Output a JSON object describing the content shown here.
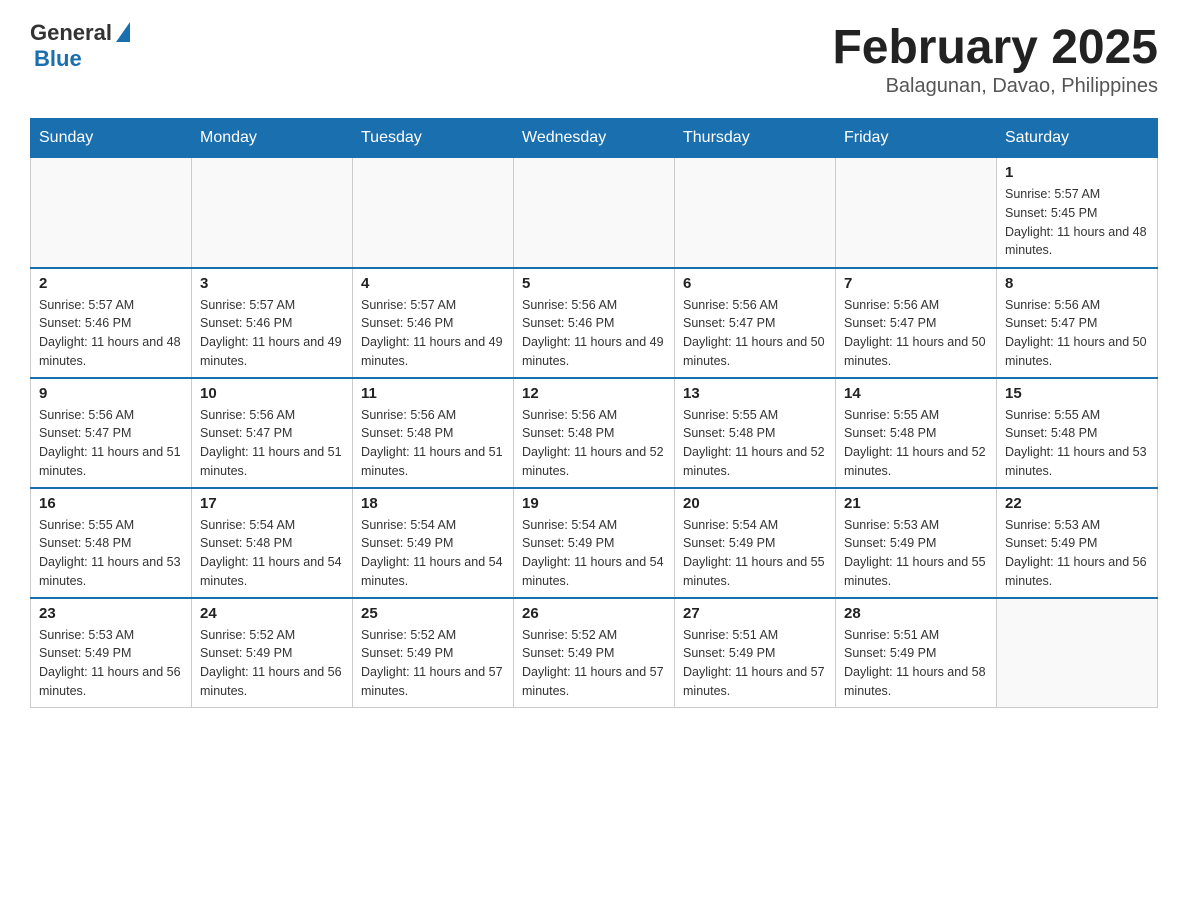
{
  "logo": {
    "general": "General",
    "blue": "Blue"
  },
  "header": {
    "title": "February 2025",
    "subtitle": "Balagunan, Davao, Philippines"
  },
  "days_of_week": [
    "Sunday",
    "Monday",
    "Tuesday",
    "Wednesday",
    "Thursday",
    "Friday",
    "Saturday"
  ],
  "weeks": [
    [
      {
        "day": "",
        "info": ""
      },
      {
        "day": "",
        "info": ""
      },
      {
        "day": "",
        "info": ""
      },
      {
        "day": "",
        "info": ""
      },
      {
        "day": "",
        "info": ""
      },
      {
        "day": "",
        "info": ""
      },
      {
        "day": "1",
        "info": "Sunrise: 5:57 AM\nSunset: 5:45 PM\nDaylight: 11 hours and 48 minutes."
      }
    ],
    [
      {
        "day": "2",
        "info": "Sunrise: 5:57 AM\nSunset: 5:46 PM\nDaylight: 11 hours and 48 minutes."
      },
      {
        "day": "3",
        "info": "Sunrise: 5:57 AM\nSunset: 5:46 PM\nDaylight: 11 hours and 49 minutes."
      },
      {
        "day": "4",
        "info": "Sunrise: 5:57 AM\nSunset: 5:46 PM\nDaylight: 11 hours and 49 minutes."
      },
      {
        "day": "5",
        "info": "Sunrise: 5:56 AM\nSunset: 5:46 PM\nDaylight: 11 hours and 49 minutes."
      },
      {
        "day": "6",
        "info": "Sunrise: 5:56 AM\nSunset: 5:47 PM\nDaylight: 11 hours and 50 minutes."
      },
      {
        "day": "7",
        "info": "Sunrise: 5:56 AM\nSunset: 5:47 PM\nDaylight: 11 hours and 50 minutes."
      },
      {
        "day": "8",
        "info": "Sunrise: 5:56 AM\nSunset: 5:47 PM\nDaylight: 11 hours and 50 minutes."
      }
    ],
    [
      {
        "day": "9",
        "info": "Sunrise: 5:56 AM\nSunset: 5:47 PM\nDaylight: 11 hours and 51 minutes."
      },
      {
        "day": "10",
        "info": "Sunrise: 5:56 AM\nSunset: 5:47 PM\nDaylight: 11 hours and 51 minutes."
      },
      {
        "day": "11",
        "info": "Sunrise: 5:56 AM\nSunset: 5:48 PM\nDaylight: 11 hours and 51 minutes."
      },
      {
        "day": "12",
        "info": "Sunrise: 5:56 AM\nSunset: 5:48 PM\nDaylight: 11 hours and 52 minutes."
      },
      {
        "day": "13",
        "info": "Sunrise: 5:55 AM\nSunset: 5:48 PM\nDaylight: 11 hours and 52 minutes."
      },
      {
        "day": "14",
        "info": "Sunrise: 5:55 AM\nSunset: 5:48 PM\nDaylight: 11 hours and 52 minutes."
      },
      {
        "day": "15",
        "info": "Sunrise: 5:55 AM\nSunset: 5:48 PM\nDaylight: 11 hours and 53 minutes."
      }
    ],
    [
      {
        "day": "16",
        "info": "Sunrise: 5:55 AM\nSunset: 5:48 PM\nDaylight: 11 hours and 53 minutes."
      },
      {
        "day": "17",
        "info": "Sunrise: 5:54 AM\nSunset: 5:48 PM\nDaylight: 11 hours and 54 minutes."
      },
      {
        "day": "18",
        "info": "Sunrise: 5:54 AM\nSunset: 5:49 PM\nDaylight: 11 hours and 54 minutes."
      },
      {
        "day": "19",
        "info": "Sunrise: 5:54 AM\nSunset: 5:49 PM\nDaylight: 11 hours and 54 minutes."
      },
      {
        "day": "20",
        "info": "Sunrise: 5:54 AM\nSunset: 5:49 PM\nDaylight: 11 hours and 55 minutes."
      },
      {
        "day": "21",
        "info": "Sunrise: 5:53 AM\nSunset: 5:49 PM\nDaylight: 11 hours and 55 minutes."
      },
      {
        "day": "22",
        "info": "Sunrise: 5:53 AM\nSunset: 5:49 PM\nDaylight: 11 hours and 56 minutes."
      }
    ],
    [
      {
        "day": "23",
        "info": "Sunrise: 5:53 AM\nSunset: 5:49 PM\nDaylight: 11 hours and 56 minutes."
      },
      {
        "day": "24",
        "info": "Sunrise: 5:52 AM\nSunset: 5:49 PM\nDaylight: 11 hours and 56 minutes."
      },
      {
        "day": "25",
        "info": "Sunrise: 5:52 AM\nSunset: 5:49 PM\nDaylight: 11 hours and 57 minutes."
      },
      {
        "day": "26",
        "info": "Sunrise: 5:52 AM\nSunset: 5:49 PM\nDaylight: 11 hours and 57 minutes."
      },
      {
        "day": "27",
        "info": "Sunrise: 5:51 AM\nSunset: 5:49 PM\nDaylight: 11 hours and 57 minutes."
      },
      {
        "day": "28",
        "info": "Sunrise: 5:51 AM\nSunset: 5:49 PM\nDaylight: 11 hours and 58 minutes."
      },
      {
        "day": "",
        "info": ""
      }
    ]
  ]
}
